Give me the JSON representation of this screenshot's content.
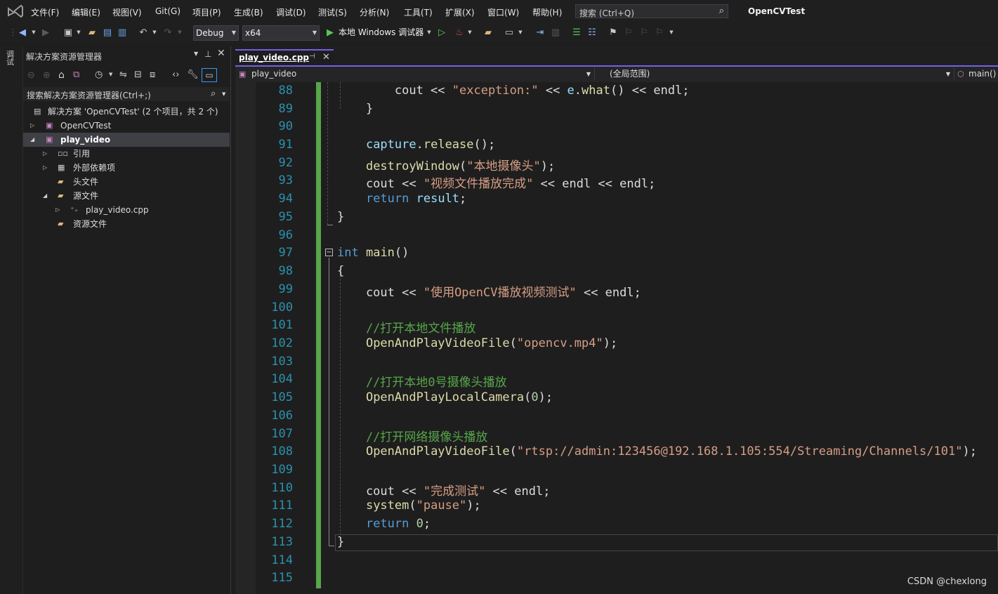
{
  "menubar": {
    "items": [
      "文件(F)",
      "编辑(E)",
      "视图(V)",
      "Git(G)",
      "项目(P)",
      "生成(B)",
      "调试(D)",
      "测试(S)",
      "分析(N)",
      "工具(T)",
      "扩展(X)",
      "窗口(W)",
      "帮助(H)"
    ],
    "search_placeholder": "搜索 (Ctrl+Q)",
    "app_title": "OpenCVTest"
  },
  "toolbar": {
    "config": "Debug",
    "platform": "x64",
    "run_label": "本地 Windows 调试器"
  },
  "left_strip": {
    "label": "调试"
  },
  "solution_explorer": {
    "title": "解决方案资源管理器",
    "search": "搜索解决方案资源管理器(Ctrl+;)",
    "items": [
      {
        "label": "解决方案 'OpenCVTest' (2 个项目，共 2 个)"
      },
      {
        "label": "OpenCVTest"
      },
      {
        "label": "play_video"
      },
      {
        "label": "引用"
      },
      {
        "label": "外部依赖项"
      },
      {
        "label": "头文件"
      },
      {
        "label": "源文件"
      },
      {
        "label": "play_video.cpp"
      },
      {
        "label": "资源文件"
      }
    ]
  },
  "editor": {
    "tab_name": "play_video.cpp",
    "nav_project": "play_video",
    "nav_scope": "(全局范围)",
    "nav_member": "main()",
    "line_numbers": [
      "88",
      "89",
      "90",
      "91",
      "92",
      "93",
      "94",
      "95",
      "96",
      "97",
      "98",
      "99",
      "100",
      "101",
      "102",
      "103",
      "104",
      "105",
      "106",
      "107",
      "108",
      "109",
      "110",
      "111",
      "112",
      "113",
      "114",
      "115"
    ],
    "code": {
      "l88a": "        cout << ",
      "l88b": "\"exception:\"",
      "l88c": " << ",
      "l88d": "e",
      "l88e": ".",
      "l88f": "what",
      "l88g": "() << endl;",
      "l89": "    }",
      "l91a": "    ",
      "l91b": "capture",
      "l91c": ".",
      "l91d": "release",
      "l91e": "();",
      "l92a": "    ",
      "l92b": "destroyWindow",
      "l92c": "(",
      "l92d": "\"本地摄像头\"",
      "l92e": ");",
      "l93a": "    cout << ",
      "l93b": "\"视频文件播放完成\"",
      "l93c": " << endl << endl;",
      "l94a": "    ",
      "l94b": "return",
      "l94c": " ",
      "l94d": "result",
      "l94e": ";",
      "l95": "}",
      "l97a": "int",
      "l97b": " ",
      "l97c": "main",
      "l97d": "()",
      "l98": "{",
      "l99a": "    cout << ",
      "l99b": "\"使用OpenCV播放视频测试\"",
      "l99c": " << endl;",
      "l101": "    //打开本地文件播放",
      "l102a": "    ",
      "l102b": "OpenAndPlayVideoFile",
      "l102c": "(",
      "l102d": "\"opencv.mp4\"",
      "l102e": ");",
      "l104": "    //打开本地0号摄像头播放",
      "l105a": "    ",
      "l105b": "OpenAndPlayLocalCamera",
      "l105c": "(",
      "l105d": "0",
      "l105e": ");",
      "l107": "    //打开网络摄像头播放",
      "l108a": "    ",
      "l108b": "OpenAndPlayVideoFile",
      "l108c": "(",
      "l108d": "\"rtsp://admin:123456@192.168.1.105:554/Streaming/Channels/101\"",
      "l108e": ");",
      "l110a": "    cout << ",
      "l110b": "\"完成测试\"",
      "l110c": " << endl;",
      "l111a": "    ",
      "l111b": "system",
      "l111c": "(",
      "l111d": "\"pause\"",
      "l111e": ");",
      "l112a": "    ",
      "l112b": "return",
      "l112c": " ",
      "l112d": "0",
      "l112e": ";",
      "l113": "}"
    }
  },
  "watermark": "CSDN @chexlong"
}
